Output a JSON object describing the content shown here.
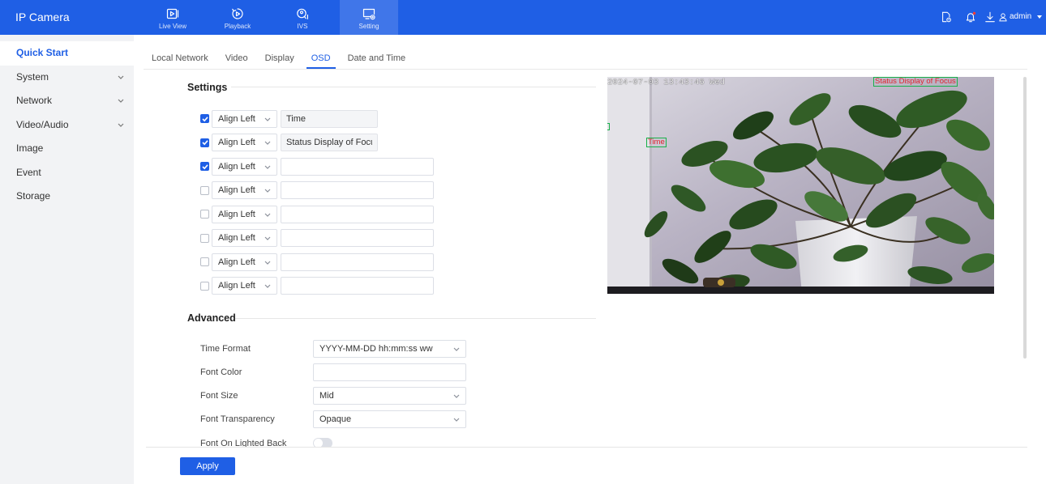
{
  "app": {
    "title": "IP Camera"
  },
  "theme": {
    "primary": "#1f5fe5",
    "overlay_text": "#e0242f",
    "overlay_box": "#19b04a"
  },
  "topnav": {
    "items": [
      {
        "label": "Live View",
        "icon": "live-view-icon"
      },
      {
        "label": "Playback",
        "icon": "playback-icon"
      },
      {
        "label": "IVS",
        "icon": "ivs-icon"
      },
      {
        "label": "Setting",
        "icon": "setting-icon",
        "active": true
      }
    ]
  },
  "header_right": {
    "icons": [
      "device-config-icon",
      "bell-icon",
      "download-icon",
      "user-icon"
    ],
    "user": "admin"
  },
  "sidebar": {
    "items": [
      {
        "label": "Quick Start",
        "active": true
      },
      {
        "label": "System",
        "expandable": true
      },
      {
        "label": "Network",
        "expandable": true
      },
      {
        "label": "Video/Audio",
        "expandable": true
      },
      {
        "label": "Image"
      },
      {
        "label": "Event"
      },
      {
        "label": "Storage"
      }
    ]
  },
  "tabs": [
    {
      "label": "Local Network"
    },
    {
      "label": "Video"
    },
    {
      "label": "Display"
    },
    {
      "label": "OSD",
      "active": true
    },
    {
      "label": "Date and Time"
    }
  ],
  "settings": {
    "title": "Settings",
    "rows": [
      {
        "checked": true,
        "position": "Align Left",
        "text": "Time"
      },
      {
        "checked": true,
        "position": "Align Left",
        "text": "Status Display of Focus"
      },
      {
        "checked": true,
        "position": "Align Left",
        "text": ""
      },
      {
        "checked": false,
        "position": "Align Left",
        "text": ""
      },
      {
        "checked": false,
        "position": "Align Left",
        "text": ""
      },
      {
        "checked": false,
        "position": "Align Left",
        "text": ""
      },
      {
        "checked": false,
        "position": "Align Left",
        "text": ""
      },
      {
        "checked": false,
        "position": "Align Left",
        "text": ""
      }
    ]
  },
  "advanced": {
    "title": "Advanced",
    "time_format": {
      "label": "Time Format",
      "value": "YYYY-MM-DD hh:mm:ss ww"
    },
    "font_color": {
      "label": "Font Color",
      "value": ""
    },
    "font_size": {
      "label": "Font Size",
      "value": "Mid"
    },
    "font_transparency": {
      "label": "Font Transparency",
      "value": "Opaque"
    },
    "font_on_lighted_back": {
      "label": "Font On Lighted Back",
      "enabled": false
    }
  },
  "preview": {
    "timestamp": "2024-07-03 13:43:46 Wed",
    "overlay_focus": "Status Display of Focus",
    "overlay_time": "Time"
  },
  "actions": {
    "apply": "Apply"
  }
}
